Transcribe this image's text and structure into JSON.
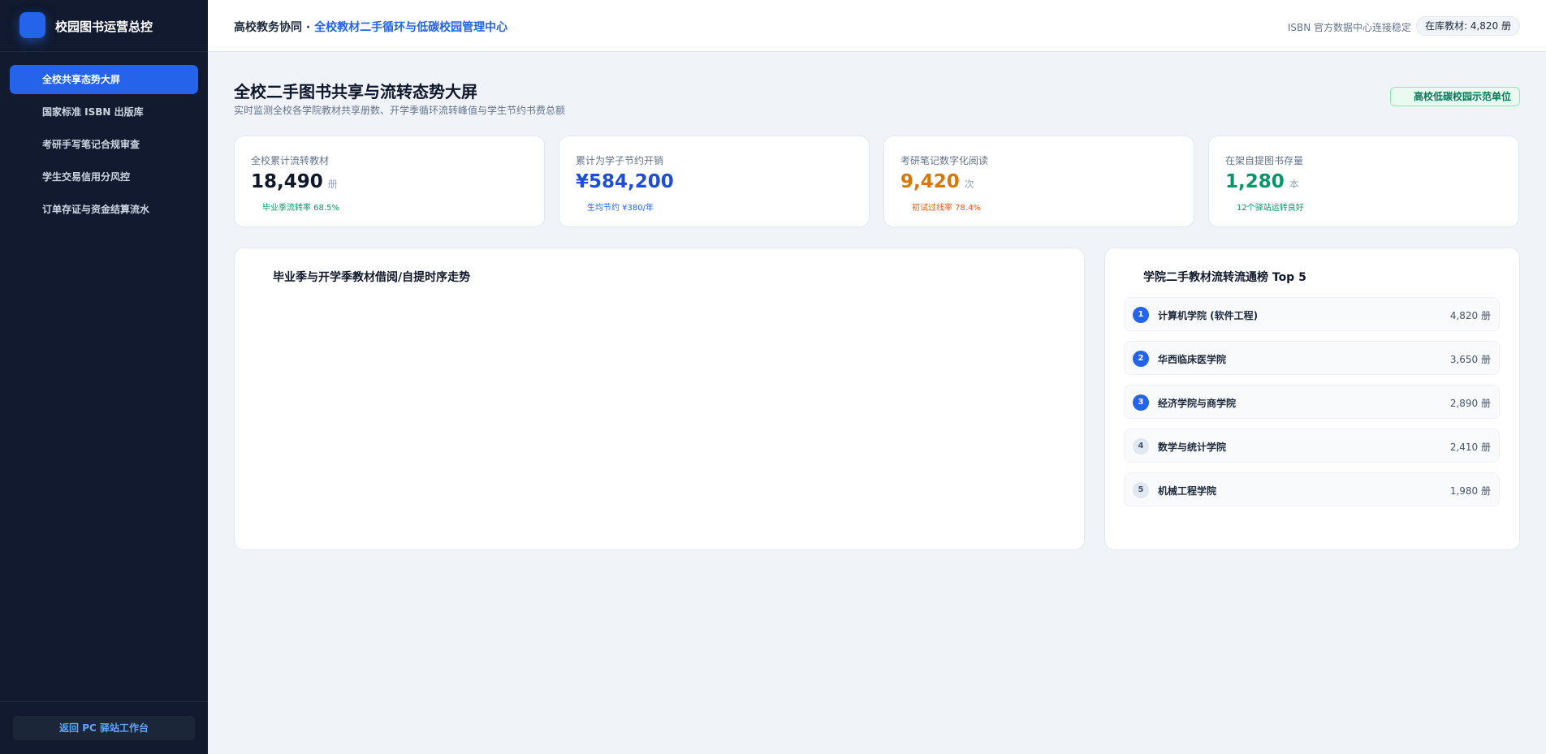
{
  "sidebar": {
    "brand_title": "校园图书运营总控",
    "nav_items": [
      {
        "label": "全校共享态势大屏",
        "active": true
      },
      {
        "label": "国家标准 ISBN 出版库",
        "active": false
      },
      {
        "label": "考研手写笔记合规审查",
        "active": false
      },
      {
        "label": "学生交易信用分风控",
        "active": false
      },
      {
        "label": "订单存证与资金结算流水",
        "active": false
      }
    ],
    "back_button": "返回 PC 驿站工作台"
  },
  "header": {
    "crumb_prefix": "高校教务协同",
    "crumb_separator": "·",
    "crumb_current": "全校教材二手循环与低碳校园管理中心",
    "connection_status": "ISBN 官方数据中心连接稳定",
    "stock_badge": "在库教材: 4,820 册"
  },
  "page": {
    "title": "全校二手图书共享与流转态势大屏",
    "subtitle": "实时监测全校各学院教材共享册数、开学季循环流转峰值与学生节约书费总额",
    "badge": "高校低碳校园示范单位"
  },
  "kpis": [
    {
      "label": "全校累计流转教材",
      "value": "18,490",
      "unit": "册",
      "sub": "毕业季流转率 68.5%",
      "value_color": "#0f172a",
      "sub_color": "#059669"
    },
    {
      "label": "累计为学子节约开销",
      "value": "¥584,200",
      "unit": "",
      "sub": "生均节约 ¥380/年",
      "value_color": "#1d4ed8",
      "sub_color": "#2563eb"
    },
    {
      "label": "考研笔记数字化阅读",
      "value": "9,420",
      "unit": "次",
      "sub": "初试过线率 78.4%",
      "value_color": "#d97706",
      "sub_color": "#ea580c"
    },
    {
      "label": "在架自提图书存量",
      "value": "1,280",
      "unit": "本",
      "sub": "12个驿站运转良好",
      "value_color": "#059669",
      "sub_color": "#059669"
    }
  ],
  "trend_panel": {
    "title": "毕业季与开学季教材借阅/自提时序走势"
  },
  "ranking_panel": {
    "title": "学院二手教材流转流通榜 Top 5",
    "items": [
      {
        "rank": "1",
        "name": "计算机学院 (软件工程)",
        "count": "4,820 册"
      },
      {
        "rank": "2",
        "name": "华西临床医学院",
        "count": "3,650 册"
      },
      {
        "rank": "3",
        "name": "经济学院与商学院",
        "count": "2,890 册"
      },
      {
        "rank": "4",
        "name": "数学与统计学院",
        "count": "2,410 册"
      },
      {
        "rank": "5",
        "name": "机械工程学院",
        "count": "1,980 册"
      }
    ]
  }
}
